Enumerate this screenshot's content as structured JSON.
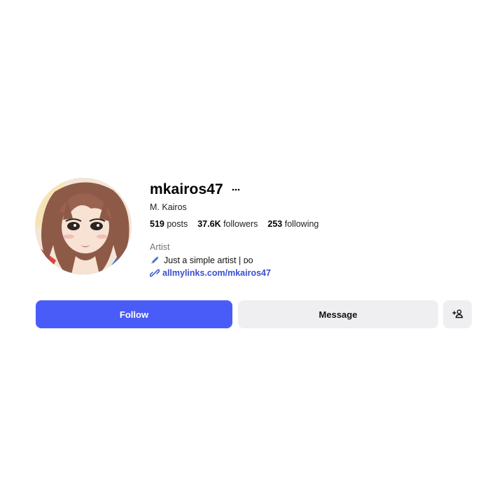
{
  "profile": {
    "username": "mkairos47",
    "display_name": "M. Kairos",
    "avatar_alt": "profile picture",
    "more_icon": "ellipsis-icon",
    "stats": {
      "posts_count": "519",
      "posts_label": "posts",
      "followers_count": "37.6K",
      "followers_label": "followers",
      "following_count": "253",
      "following_label": "following"
    },
    "category": "Artist",
    "bio_text": "Just a simple artist | ᴅᴏ",
    "bio_icon": "pen-icon",
    "link": "allmylinks.com/mkairos47",
    "link_icon": "link-icon"
  },
  "actions": {
    "follow_label": "Follow",
    "message_label": "Message",
    "suggest_icon": "add-person-icon"
  },
  "colors": {
    "follow_bg": "#4a5cf7",
    "secondary_bg": "#efeff2",
    "link": "#3a4fcf",
    "muted": "#737373"
  }
}
